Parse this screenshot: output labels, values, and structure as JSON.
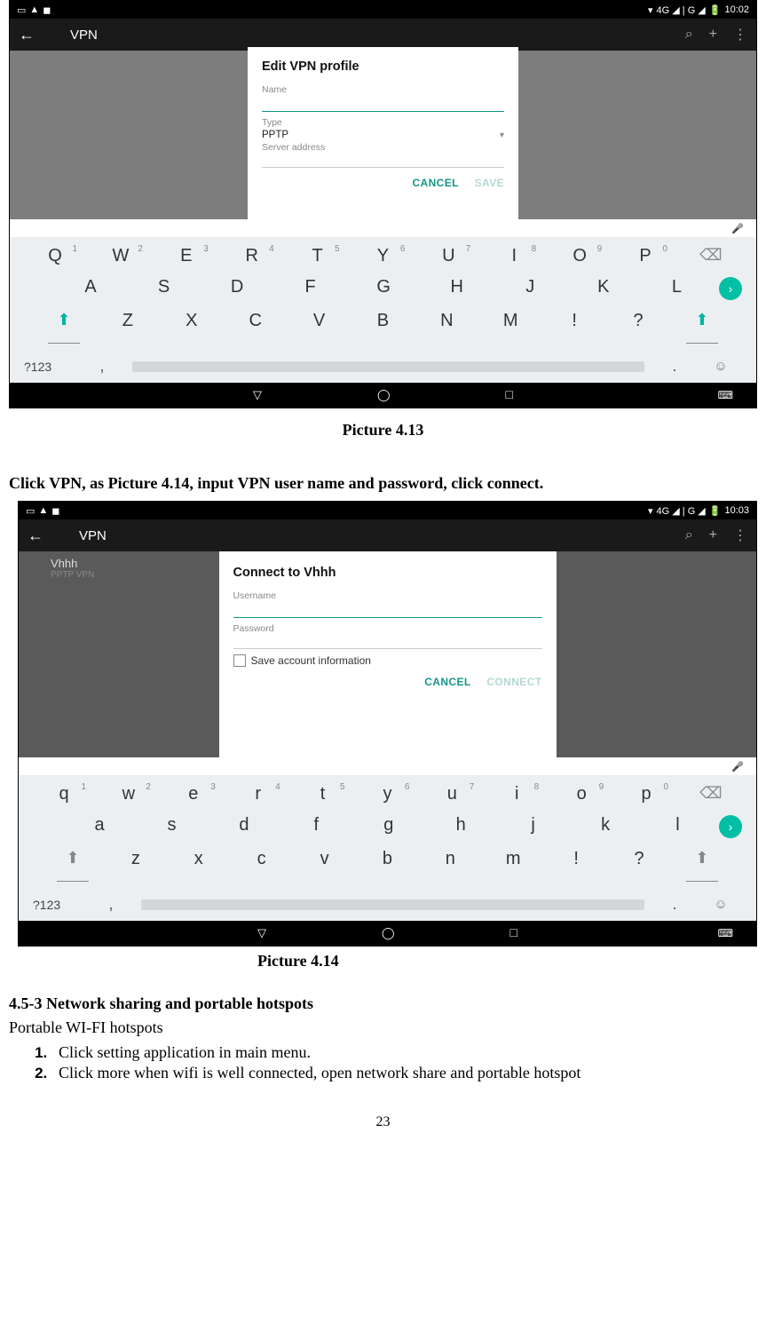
{
  "status": {
    "signal": "4G ◢ | G ◢",
    "battery": "🔋",
    "time1": "10:02",
    "time2": "10:03"
  },
  "appbar": {
    "title": "VPN"
  },
  "dialog1": {
    "title": "Edit VPN profile",
    "name_label": "Name",
    "type_label": "Type",
    "type_value": "PPTP",
    "server_label": "Server address",
    "cancel": "CANCEL",
    "save": "SAVE"
  },
  "dialog2": {
    "title": "Connect to Vhhh",
    "user_label": "Username",
    "pass_label": "Password",
    "save_info": "Save account information",
    "cancel": "CANCEL",
    "connect": "CONNECT"
  },
  "vpn_item": {
    "name": "Vhhh",
    "sub": "PPTP VPN"
  },
  "keyboard_upper": {
    "row1": [
      {
        "k": "Q",
        "n": "1"
      },
      {
        "k": "W",
        "n": "2"
      },
      {
        "k": "E",
        "n": "3"
      },
      {
        "k": "R",
        "n": "4"
      },
      {
        "k": "T",
        "n": "5"
      },
      {
        "k": "Y",
        "n": "6"
      },
      {
        "k": "U",
        "n": "7"
      },
      {
        "k": "I",
        "n": "8"
      },
      {
        "k": "O",
        "n": "9"
      },
      {
        "k": "P",
        "n": "0"
      }
    ],
    "row2": [
      "A",
      "S",
      "D",
      "F",
      "G",
      "H",
      "J",
      "K",
      "L"
    ],
    "row3": [
      "Z",
      "X",
      "C",
      "V",
      "B",
      "N",
      "M",
      "!",
      "?"
    ],
    "sym": "?123"
  },
  "keyboard_lower": {
    "row1": [
      {
        "k": "q",
        "n": "1"
      },
      {
        "k": "w",
        "n": "2"
      },
      {
        "k": "e",
        "n": "3"
      },
      {
        "k": "r",
        "n": "4"
      },
      {
        "k": "t",
        "n": "5"
      },
      {
        "k": "y",
        "n": "6"
      },
      {
        "k": "u",
        "n": "7"
      },
      {
        "k": "i",
        "n": "8"
      },
      {
        "k": "o",
        "n": "9"
      },
      {
        "k": "p",
        "n": "0"
      }
    ],
    "row2": [
      "a",
      "s",
      "d",
      "f",
      "g",
      "h",
      "j",
      "k",
      "l"
    ],
    "row3": [
      "z",
      "x",
      "c",
      "v",
      "b",
      "n",
      "m",
      "!",
      "?"
    ],
    "sym": "?123"
  },
  "captions": {
    "c1": "Picture 4.13",
    "c2": "Picture 4.14"
  },
  "text": {
    "p1": "Click VPN, as Picture 4.14, input VPN user name and password, click connect.",
    "h2": "4.5-3 Network sharing and portable hotspots",
    "p2": "Portable WI-FI hotspots",
    "li1": "Click setting application in main menu.",
    "li2": "Click more when wifi is well connected, open network share and portable hotspot"
  },
  "page_number": "23"
}
